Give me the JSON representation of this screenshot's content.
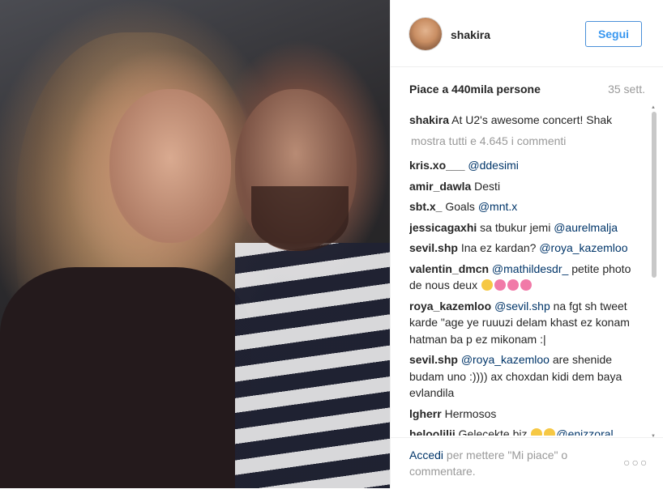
{
  "post": {
    "username": "shakira",
    "follow_label": "Segui",
    "likes_text": "Piace a 440mila persone",
    "time_ago": "35 sett.",
    "caption": {
      "user": "shakira",
      "text": "At U2's awesome concert! Shak"
    },
    "show_all_comments": "mostra tutti e 4.645 i commenti",
    "comments": [
      {
        "user": "kris.xo___",
        "text": "",
        "mention": "@ddesimi",
        "after": ""
      },
      {
        "user": "amir_dawla",
        "text": "Desti",
        "mention": "",
        "after": ""
      },
      {
        "user": "sbt.x_",
        "text": "Goals",
        "mention": "@mnt.x",
        "after": ""
      },
      {
        "user": "jessicagaxhi",
        "text": "sa tbukur jemi",
        "mention": "@aurelmalja",
        "after": ""
      },
      {
        "user": "sevil.shp",
        "text": "Ina ez kardan?",
        "mention": "@roya_kazemloo",
        "after": ""
      },
      {
        "user": "valentin_dmcn",
        "text": "",
        "mention": "@mathildesdr_",
        "after": "petite photo de nous deux"
      },
      {
        "user": "roya_kazemloo",
        "text": "",
        "mention": "@sevil.shp",
        "after": "na fgt sh tweet karde \"age ye ruuuzi delam khast ez konam hatman ba p ez mikonam :|"
      },
      {
        "user": "sevil.shp",
        "text": "",
        "mention": "@roya_kazemloo",
        "after": "are shenide budam uno :)))) ax choxdan kidi dem baya evlandila"
      },
      {
        "user": "lgherr",
        "text": "Hermosos",
        "mention": "",
        "after": ""
      },
      {
        "user": "heloolilii",
        "text": "Gelecekte biz",
        "mention": "@enizzoral",
        "after": ""
      }
    ],
    "footer": {
      "login_link": "Accedi",
      "login_text": "per mettere \"Mi piace\" o commentare.",
      "more_label": "○○○"
    }
  },
  "icons": {
    "more": "more-options-icon",
    "avatar": "profile-avatar"
  }
}
